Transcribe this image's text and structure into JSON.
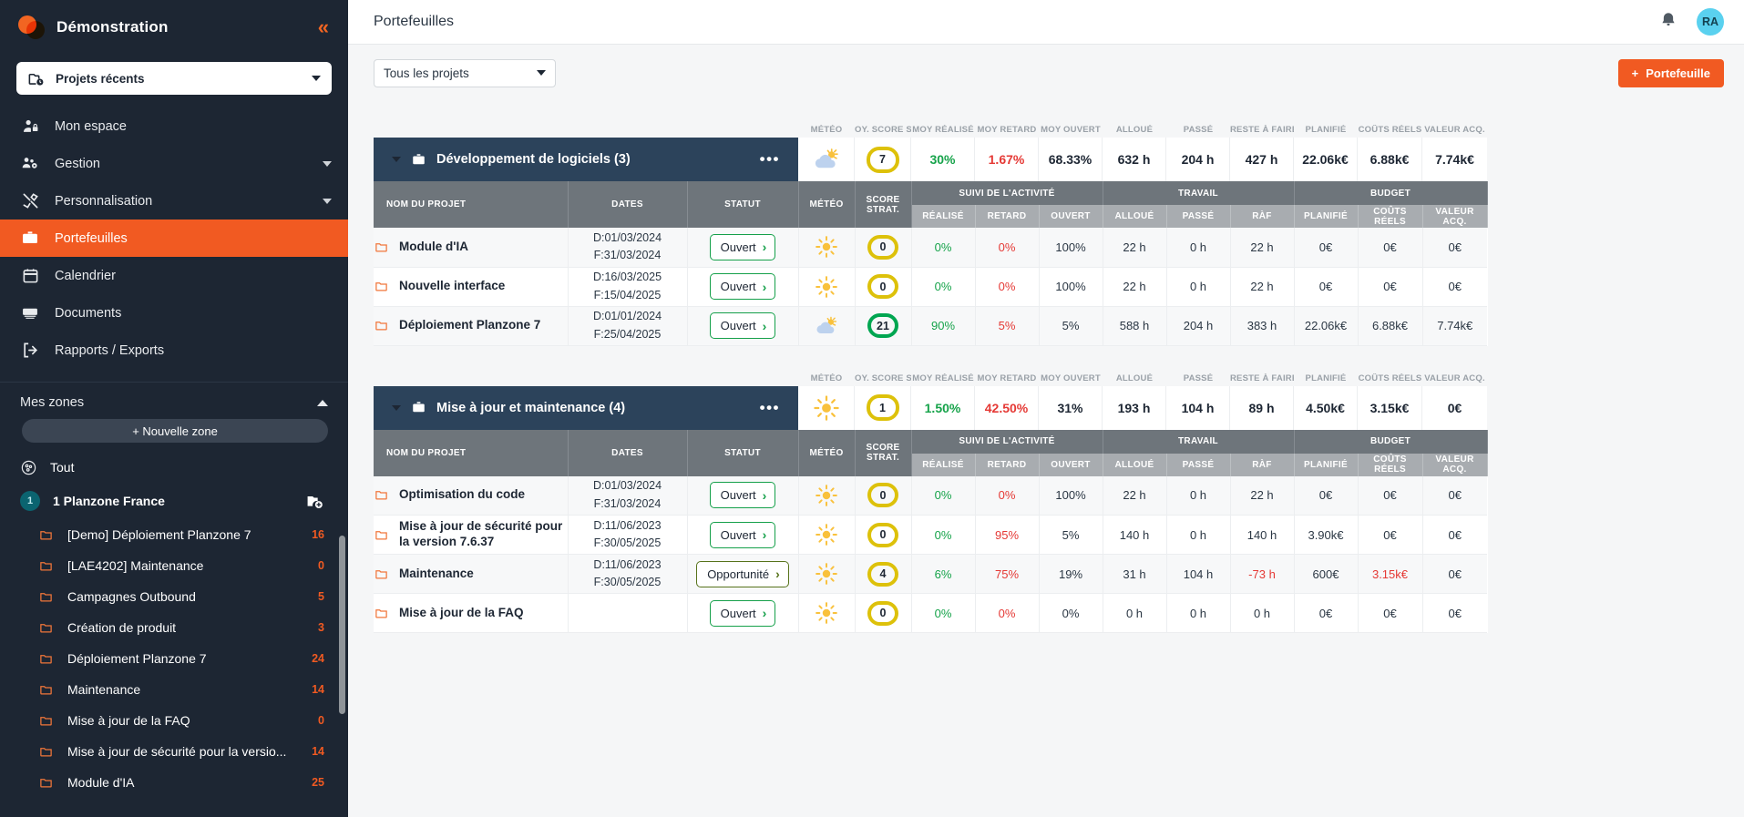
{
  "sidebar": {
    "brand": "Démonstration",
    "collapse_icon": "double-chevron-left-icon",
    "project_picker": {
      "label": "Projets récents",
      "icon": "folder-clock-icon"
    },
    "nav": [
      {
        "label": "Mon espace",
        "icon": "user-lock-icon",
        "active": false,
        "expandable": false
      },
      {
        "label": "Gestion",
        "icon": "users-gear-icon",
        "active": false,
        "expandable": true
      },
      {
        "label": "Personnalisation",
        "icon": "tools-icon",
        "active": false,
        "expandable": true
      },
      {
        "label": "Portefeuilles",
        "icon": "portfolio-icon",
        "active": true,
        "expandable": false
      },
      {
        "label": "Calendrier",
        "icon": "calendar-icon",
        "active": false,
        "expandable": false
      },
      {
        "label": "Documents",
        "icon": "documents-icon",
        "active": false,
        "expandable": false
      },
      {
        "label": "Rapports / Exports",
        "icon": "export-icon",
        "active": false,
        "expandable": false
      }
    ],
    "zones": {
      "title": "Mes zones",
      "new_zone_label": "+ Nouvelle zone",
      "all_label": "Tout",
      "group": {
        "badge": "1",
        "label": "1 Planzone France",
        "add_icon": "folder-plus-icon"
      },
      "items": [
        {
          "label": "[Demo] Déploiement Planzone 7",
          "count": "16"
        },
        {
          "label": "[LAE4202] Maintenance",
          "count": "0"
        },
        {
          "label": "Campagnes Outbound",
          "count": "5"
        },
        {
          "label": "Création de produit",
          "count": "3"
        },
        {
          "label": "Déploiement Planzone 7",
          "count": "24"
        },
        {
          "label": "Maintenance",
          "count": "14"
        },
        {
          "label": "Mise à jour de la FAQ",
          "count": "0"
        },
        {
          "label": "Mise à jour de sécurité pour la versio...",
          "count": "14"
        },
        {
          "label": "Module d'IA",
          "count": "25"
        }
      ]
    }
  },
  "topbar": {
    "page_title": "Portefeuilles",
    "bell_icon": "bell-icon",
    "avatar_initials": "RA"
  },
  "toolbar": {
    "project_filter": "Tous les projets",
    "new_portfolio_label": "Portefeuille",
    "new_portfolio_plus": "+"
  },
  "summary_columns": [
    "MÉTÉO",
    "OY. SCORE STRA",
    "MOY RÉALISÉ",
    "MOY RETARD",
    "MOY OUVERT",
    "ALLOUÉ",
    "PASSÉ",
    "RESTE À FAIRE",
    "PLANIFIÉ",
    "COÛTS RÉELS",
    "VALEUR ACQ."
  ],
  "table_headers": {
    "name": "NOM DU PROJET",
    "dates": "DATES",
    "status": "STATUT",
    "weather": "MÉTÉO",
    "score": "SCORE STRAT.",
    "groups": [
      {
        "label": "SUIVI DE L'ACTIVITÉ",
        "cols": [
          "RÉALISÉ",
          "RETARD",
          "OUVERT"
        ]
      },
      {
        "label": "TRAVAIL",
        "cols": [
          "ALLOUÉ",
          "PASSÉ",
          "RÀF"
        ]
      },
      {
        "label": "BUDGET",
        "cols": [
          "PLANIFIÉ",
          "COÛTS RÉELS",
          "VALEUR ACQ."
        ]
      }
    ]
  },
  "portfolios": [
    {
      "name": "Développement de logiciels (3)",
      "menu_icon": "ellipsis-icon",
      "weather": "partly-cloudy",
      "score": "7",
      "score_color": "yellow",
      "summary": [
        "30%",
        "1.67%",
        "68.33%",
        "632 h",
        "204 h",
        "427 h",
        "22.06k€",
        "6.88k€",
        "7.74k€"
      ],
      "rows": [
        {
          "name": "Module d'IA",
          "date_start": "D:01/03/2024",
          "date_end": "F:31/03/2024",
          "status": "Ouvert",
          "status_kind": "open",
          "weather": "sunny",
          "score": "0",
          "score_color": "yellow",
          "values": [
            "0%",
            "0%",
            "100%",
            "22 h",
            "0 h",
            "22 h",
            "0€",
            "0€",
            "0€"
          ],
          "value_colors": [
            "green",
            "red",
            "",
            "",
            "",
            "",
            "",
            "",
            ""
          ]
        },
        {
          "name": "Nouvelle interface",
          "date_start": "D:16/03/2025",
          "date_end": "F:15/04/2025",
          "status": "Ouvert",
          "status_kind": "open",
          "weather": "sunny",
          "score": "0",
          "score_color": "yellow",
          "values": [
            "0%",
            "0%",
            "100%",
            "22 h",
            "0 h",
            "22 h",
            "0€",
            "0€",
            "0€"
          ],
          "value_colors": [
            "green",
            "red",
            "",
            "",
            "",
            "",
            "",
            "",
            ""
          ]
        },
        {
          "name": "Déploiement Planzone 7",
          "date_start": "D:01/01/2024",
          "date_end": "F:25/04/2025",
          "status": "Ouvert",
          "status_kind": "open",
          "weather": "partly-cloudy",
          "score": "21",
          "score_color": "green",
          "values": [
            "90%",
            "5%",
            "5%",
            "588 h",
            "204 h",
            "383 h",
            "22.06k€",
            "6.88k€",
            "7.74k€"
          ],
          "value_colors": [
            "green",
            "red",
            "",
            "",
            "",
            "",
            "",
            "",
            ""
          ]
        }
      ]
    },
    {
      "name": "Mise à jour et maintenance (4)",
      "menu_icon": "ellipsis-icon",
      "weather": "sunny",
      "score": "1",
      "score_color": "yellow",
      "summary": [
        "1.50%",
        "42.50%",
        "31%",
        "193 h",
        "104 h",
        "89 h",
        "4.50k€",
        "3.15k€",
        "0€"
      ],
      "rows": [
        {
          "name": "Optimisation du code",
          "date_start": "D:01/03/2024",
          "date_end": "F:31/03/2024",
          "status": "Ouvert",
          "status_kind": "open",
          "weather": "sunny",
          "score": "0",
          "score_color": "yellow",
          "values": [
            "0%",
            "0%",
            "100%",
            "22 h",
            "0 h",
            "22 h",
            "0€",
            "0€",
            "0€"
          ],
          "value_colors": [
            "green",
            "red",
            "",
            "",
            "",
            "",
            "",
            "",
            ""
          ]
        },
        {
          "name": "Mise à jour de sécurité pour la version 7.6.37",
          "date_start": "D:11/06/2023",
          "date_end": "F:30/05/2025",
          "status": "Ouvert",
          "status_kind": "open",
          "weather": "sunny",
          "score": "0",
          "score_color": "yellow",
          "values": [
            "0%",
            "95%",
            "5%",
            "140 h",
            "0 h",
            "140 h",
            "3.90k€",
            "0€",
            "0€"
          ],
          "value_colors": [
            "green",
            "red",
            "",
            "",
            "",
            "",
            "",
            "",
            ""
          ]
        },
        {
          "name": "Maintenance",
          "date_start": "D:11/06/2023",
          "date_end": "F:30/05/2025",
          "status": "Opportunité",
          "status_kind": "opportunity",
          "weather": "sunny",
          "score": "4",
          "score_color": "yellow",
          "values": [
            "6%",
            "75%",
            "19%",
            "31 h",
            "104 h",
            "-73 h",
            "600€",
            "3.15k€",
            "0€"
          ],
          "value_colors": [
            "green",
            "red",
            "",
            "",
            "",
            "red",
            "",
            "red",
            ""
          ]
        },
        {
          "name": "Mise à jour de la FAQ",
          "date_start": "",
          "date_end": "",
          "status": "Ouvert",
          "status_kind": "open",
          "weather": "sunny",
          "score": "0",
          "score_color": "yellow",
          "values": [
            "0%",
            "0%",
            "0%",
            "0 h",
            "0 h",
            "0 h",
            "0€",
            "0€",
            "0€"
          ],
          "value_colors": [
            "green",
            "red",
            "",
            "",
            "",
            "",
            "",
            "",
            ""
          ]
        }
      ]
    }
  ],
  "colors": {
    "accent": "#f15a22",
    "sidebar_bg": "#1d2633",
    "group_bar": "#2c435b",
    "header_dark": "#6e757b",
    "header_light": "#a8acb0",
    "green": "#16a34a",
    "red": "#e53935",
    "score_yellow": "#ddc10a",
    "score_green": "#00a651",
    "avatar_bg": "#5ad1ef"
  }
}
